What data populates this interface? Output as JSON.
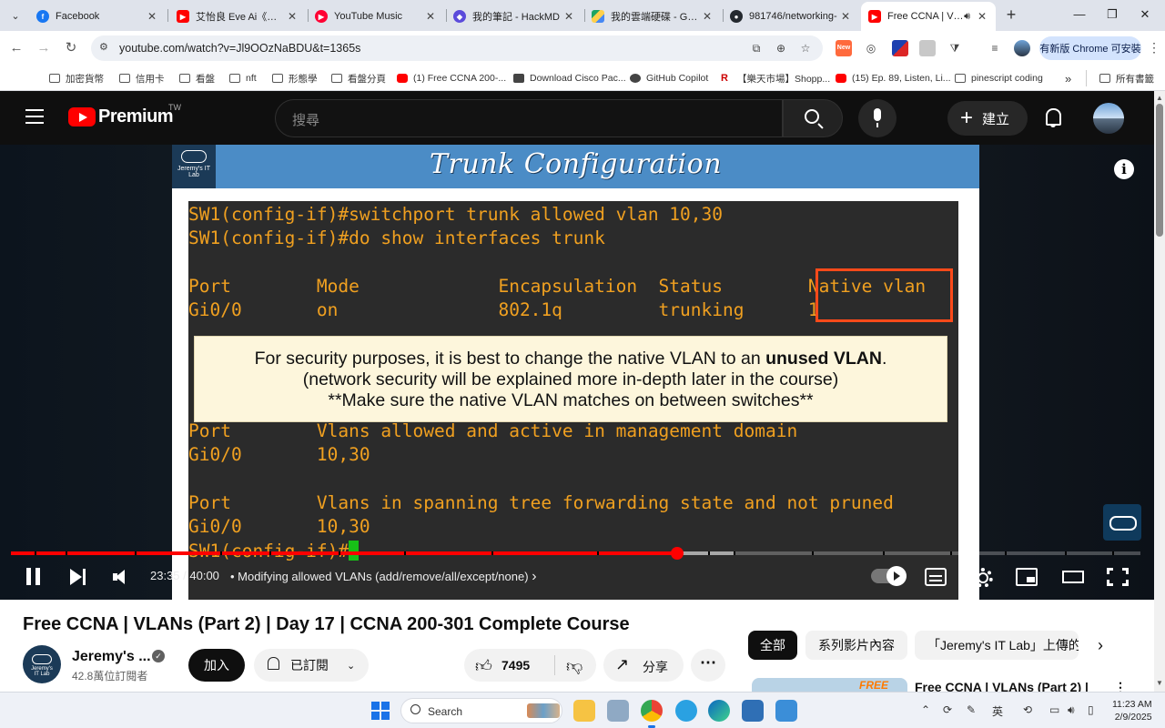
{
  "tabs": [
    {
      "title": "Facebook",
      "icon": "facebook-icon",
      "color": "#1877f2"
    },
    {
      "title": "艾怡良 Eve Ai《那時",
      "icon": "youtube-icon",
      "color": "#ff0000"
    },
    {
      "title": "YouTube Music",
      "icon": "youtube-music-icon",
      "color": "#ff0033"
    },
    {
      "title": "我的筆記 - HackMD",
      "icon": "hackmd-icon",
      "color": "#5b4bdb"
    },
    {
      "title": "我的雲端硬碟 - Goog",
      "icon": "google-drive-icon",
      "color": "#1fa463"
    },
    {
      "title": "981746/networking-",
      "icon": "github-icon",
      "color": "#24292f"
    },
    {
      "title": "Free CCNA | VLA",
      "icon": "youtube-icon",
      "color": "#ff0000",
      "active": true
    }
  ],
  "address": {
    "url": "youtube.com/watch?v=Jl9OOzNaBDU&t=1365s",
    "update_label": "有新版 Chrome 可安裝",
    "new_badge": "New"
  },
  "bookmarks": [
    {
      "label": "加密貨幣",
      "icon": "folder-icon"
    },
    {
      "label": "信用卡",
      "icon": "folder-icon"
    },
    {
      "label": "看盤",
      "icon": "folder-icon"
    },
    {
      "label": "nft",
      "icon": "folder-icon"
    },
    {
      "label": "形態學",
      "icon": "folder-icon"
    },
    {
      "label": "看盤分頁",
      "icon": "folder-icon"
    },
    {
      "label": "(1) Free CCNA 200-...",
      "icon": "youtube-icon"
    },
    {
      "label": "Download Cisco Pac...",
      "icon": "netacad-icon"
    },
    {
      "label": "GitHub Copilot",
      "icon": "github-icon"
    },
    {
      "label": "【樂天市場】Shopp...",
      "icon": "rakuten-icon"
    },
    {
      "label": "(15) Ep. 89, Listen, Li...",
      "icon": "youtube-icon"
    },
    {
      "label": "pinescript coding",
      "icon": "folder-icon"
    }
  ],
  "bookmarks_more": "»",
  "all_bookmarks": "所有書籤",
  "yt": {
    "brand": "Premium",
    "region": "TW",
    "search_placeholder": "搜尋",
    "create_label": "建立"
  },
  "slide": {
    "logo_text": "Jeremy's IT Lab",
    "title": "Trunk Configuration",
    "terminal_lines": [
      "SW1(config-if)#switchport trunk allowed vlan 10,30",
      "SW1(config-if)#do show interfaces trunk",
      "",
      "Port        Mode             Encapsulation  Status        Native vlan",
      "Gi0/0       on               802.1q         trunking      1",
      "",
      "",
      "",
      "Port        Vlans allowed and active in management domain",
      "Gi0/0       10,30",
      "",
      "Port        Vlans in spanning tree forwarding state and not pruned",
      "Gi0/0       10,30",
      "SW1(config-if)#"
    ],
    "note_line1_pre": "For security purposes, it is best to change the native VLAN to an ",
    "note_line1_bold": "unused VLAN",
    "note_line1_post": ".",
    "note_line2": "(network security will be explained more in-depth later in the course)",
    "note_line3": "**Make sure the native VLAN matches on between switches**"
  },
  "player": {
    "time": "23:35 / 40:00",
    "chapter": "• Modifying allowed VLANs (add/remove/all/except/none)",
    "chapter_chevron": "›",
    "progress_played": 0.5896,
    "progress_buffered": 0.64
  },
  "video": {
    "title": "Free CCNA | VLANs (Part 2) | Day 17 | CCNA 200-301 Complete Course",
    "channel_name": "Jeremy's ...",
    "subscribers": "42.8萬位訂閱者",
    "join_label": "加入",
    "subscribed_label": "已訂閱",
    "likes": "7495",
    "share_label": "分享",
    "more_label": "⋯"
  },
  "sidebar": {
    "chips": [
      "全部",
      "系列影片內容",
      "「Jeremy's IT Lab」上傳的"
    ],
    "next_video_title": "Free CCNA | VLANs (Part 2) |",
    "next_video_badge": "FREE"
  },
  "taskbar": {
    "search_label": "Search",
    "ime": "英",
    "time": "11:23 AM",
    "date": "2/9/2025"
  }
}
